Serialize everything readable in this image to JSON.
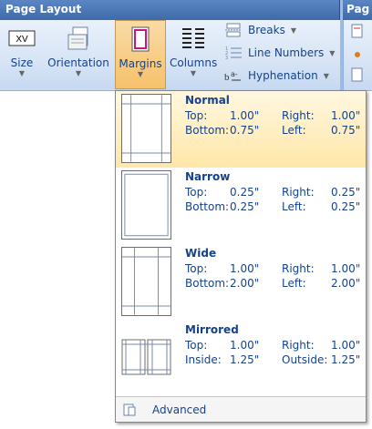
{
  "ribbon": {
    "group_title": "Page Layout",
    "next_group_title": "Pag",
    "buttons": {
      "size": "Size",
      "orientation": "Orientation",
      "margins": "Margins",
      "columns": "Columns"
    },
    "small": {
      "breaks": "Breaks",
      "line_numbers": "Line Numbers",
      "hyphenation": "Hyphenation"
    },
    "size_icon_text": "XV"
  },
  "margins_menu": {
    "items": [
      {
        "name": "Normal",
        "r1": [
          "Top:",
          "1.00\"",
          "Right:",
          "1.00\""
        ],
        "r2": [
          "Bottom:",
          "0.75\"",
          "Left:",
          "0.75\""
        ]
      },
      {
        "name": "Narrow",
        "r1": [
          "Top:",
          "0.25\"",
          "Right:",
          "0.25\""
        ],
        "r2": [
          "Bottom:",
          "0.25\"",
          "Left:",
          "0.25\""
        ]
      },
      {
        "name": "Wide",
        "r1": [
          "Top:",
          "1.00\"",
          "Right:",
          "1.00\""
        ],
        "r2": [
          "Bottom:",
          "2.00\"",
          "Left:",
          "2.00\""
        ]
      },
      {
        "name": "Mirrored",
        "r1": [
          "Top:",
          "1.00\"",
          "Right:",
          "1.00\""
        ],
        "r2": [
          "Inside:",
          "1.25\"",
          "Outside:",
          "1.25\""
        ]
      }
    ],
    "footer": "Advanced"
  },
  "colors": {
    "text": "#15428b",
    "active": "#f6c16b",
    "ribbon": "#d7e4f5"
  }
}
